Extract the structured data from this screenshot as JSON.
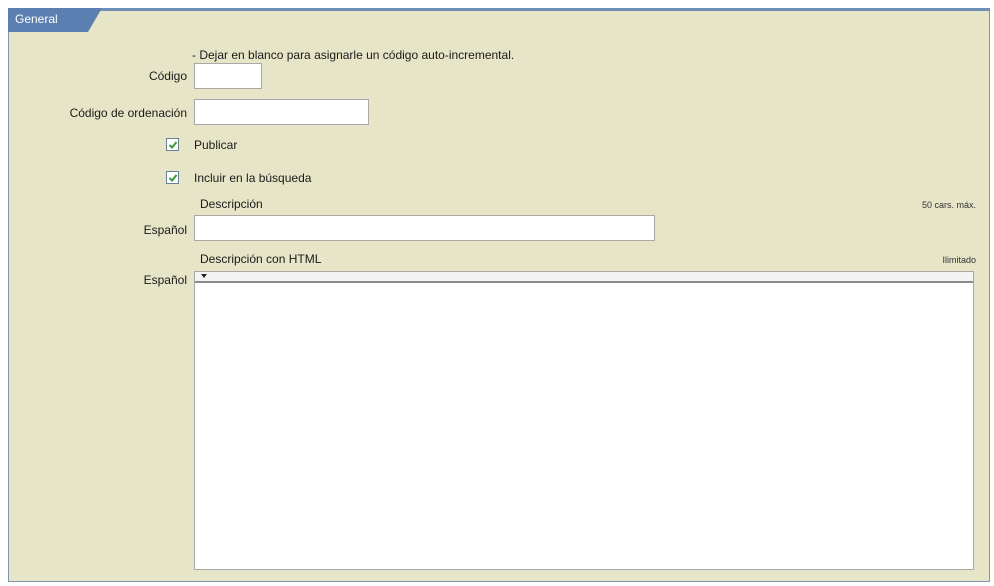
{
  "panel": {
    "tab_label": "General"
  },
  "form": {
    "hint_codigo": "- Dejar en blanco para asignarle un código auto-incremental.",
    "codigo_label": "Código",
    "codigo_value": "",
    "orden_label": "Código de ordenación",
    "orden_value": "",
    "publicar_label": "Publicar",
    "publicar_checked": true,
    "busqueda_label": "Incluir en la búsqueda",
    "busqueda_checked": true,
    "descripcion_heading": "Descripción",
    "descripcion_limit": "50 cars. máx.",
    "descripcion_lang": "Español",
    "descripcion_value": "",
    "html_heading": "Descripción con HTML",
    "html_limit": "Ilimitado",
    "html_lang": "Español",
    "html_value": ""
  },
  "colors": {
    "panel_bg": "#e6e5c7",
    "tab_bg": "#5a7fb0",
    "border": "#7f95ad",
    "check": "#3a9a3a"
  },
  "icons": [
    "checkbox-checked-icon",
    "dropdown-arrow-icon"
  ]
}
